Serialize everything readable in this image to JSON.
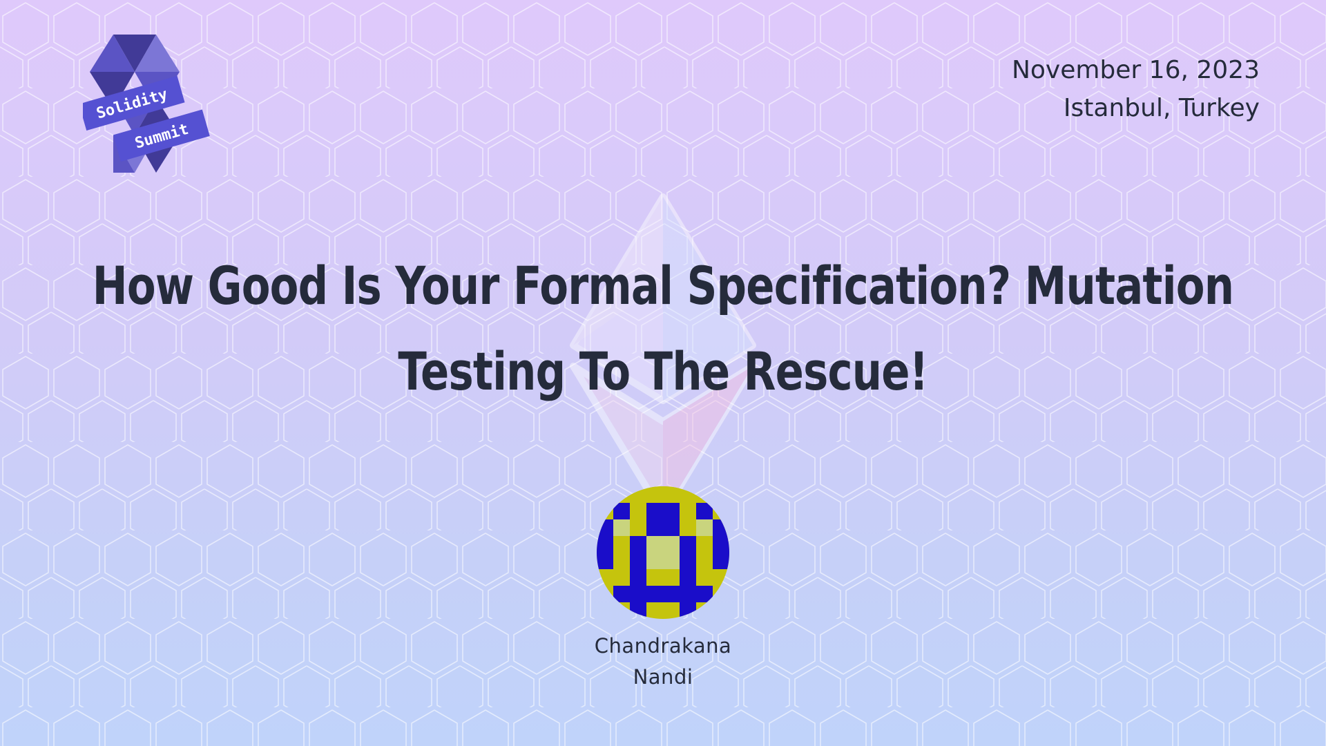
{
  "logo": {
    "line1": "Solidity",
    "line2": "Summit",
    "colors": {
      "dark": "#413a97",
      "mid": "#5b54c4",
      "light": "#7c76d6",
      "banner": "#5551d2"
    }
  },
  "event": {
    "date": "November 16, 2023",
    "location": "Istanbul, Turkey"
  },
  "talk": {
    "title": "How Good Is Your Formal Specification? Mutation Testing To The Rescue!"
  },
  "speaker": {
    "first_name": "Chandrakana",
    "last_name": "Nandi",
    "avatar_icon": "identicon-avatar",
    "avatar_colors": {
      "yellow": "#c5c40d",
      "blue": "#1a0dc9",
      "pale": "#c9d47e"
    }
  },
  "background": {
    "icon": "ethereum-watermark-icon",
    "colors": {
      "top": "#dfc9fb",
      "bottom": "#c0d3fa"
    }
  }
}
